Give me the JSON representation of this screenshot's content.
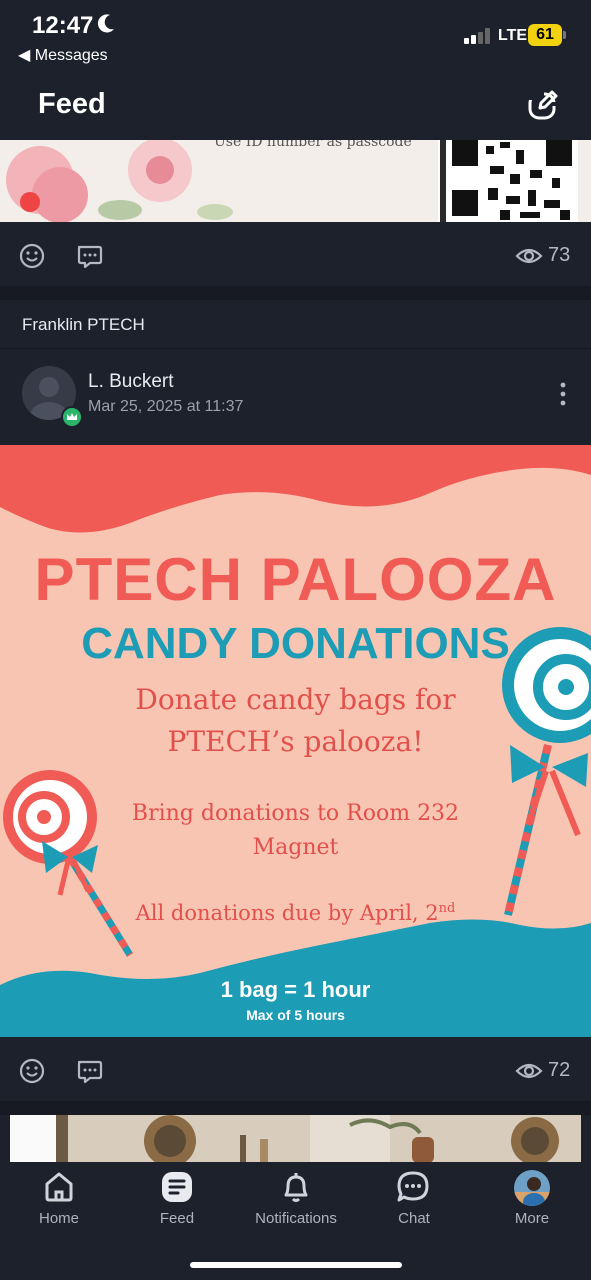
{
  "status": {
    "time": "12:47",
    "back_label": "◀ Messages",
    "network": "LTE",
    "battery": "61"
  },
  "header": {
    "title": "Feed"
  },
  "post1": {
    "partial_text": "Use ID number as passcode",
    "view_count": "73"
  },
  "group": {
    "name": "Franklin PTECH"
  },
  "post2": {
    "author": "L. Buckert",
    "timestamp": "Mar 25, 2025 at 11:37",
    "flyer": {
      "title": "PTECH PALOOZA",
      "subtitle": "CANDY DONATIONS",
      "line1": "Donate candy bags for",
      "line2": "PTECH’s palooza!",
      "line3": "Bring donations to Room 232",
      "line4": "Magnet",
      "line5": "All donations due by April, 2",
      "line5_sup": "nd",
      "bag_rule": "1 bag = 1 hour",
      "max_rule": "Max of 5 hours"
    },
    "view_count": "72"
  },
  "tabs": [
    {
      "label": "Home",
      "icon": "home-icon"
    },
    {
      "label": "Feed",
      "icon": "feed-icon"
    },
    {
      "label": "Notifications",
      "icon": "bell-icon"
    },
    {
      "label": "Chat",
      "icon": "chat-icon"
    },
    {
      "label": "More",
      "icon": "profile-avatar"
    }
  ],
  "colors": {
    "background": "#1d212b",
    "flyer_red": "#f05b55",
    "flyer_teal": "#1c9cb5",
    "flyer_peach": "#f8c5b3"
  }
}
